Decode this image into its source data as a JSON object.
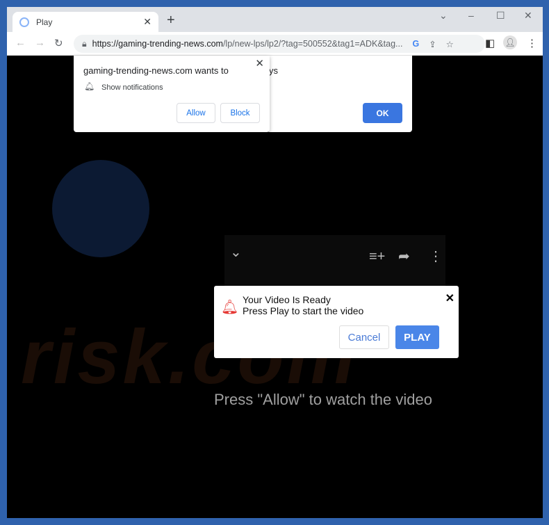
{
  "browser": {
    "tab_title": "Play",
    "url_host": "https://gaming-trending-news.com",
    "url_path": "/lp/new-lps/lp2/?tag=500552&tag1=ADK&tag..."
  },
  "permission": {
    "heading": "gaming-trending-news.com wants to",
    "item": "Show notifications",
    "allow": "Allow",
    "block": "Block"
  },
  "back_dialog": {
    "fragment": "ys",
    "ok": "OK"
  },
  "video_dialog": {
    "line1": "Your Video Is Ready",
    "line2": "Press Play to start the video",
    "cancel": "Cancel",
    "play": "PLAY"
  },
  "page": {
    "instruction": "Press \"Allow\" to watch the video",
    "watermark": "risk.com"
  },
  "colors": {
    "frame": "#2f62ad",
    "play_button": "#4a86e8",
    "ok_button": "#3a76e0",
    "bell": "#e53935"
  }
}
